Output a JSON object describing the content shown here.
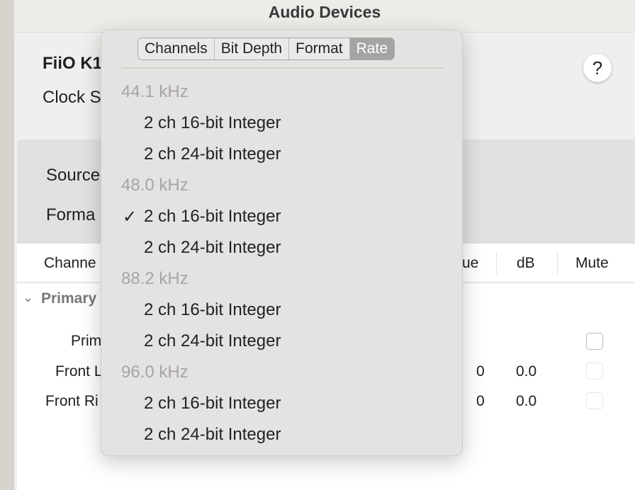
{
  "window": {
    "title": "Audio Devices"
  },
  "device": {
    "name": "FiiO K1",
    "clock_label": "Clock S"
  },
  "help_label": "?",
  "settings": {
    "source_label": "Source",
    "format_label": "Forma"
  },
  "table": {
    "headers": [
      "Channe",
      "ue",
      "dB",
      "Mute"
    ],
    "group": "Primary",
    "rows": [
      {
        "name": "Prim",
        "value": "",
        "db": "",
        "mute": false
      },
      {
        "name": "Front L",
        "value": "0",
        "db": "0.0",
        "mute": false
      },
      {
        "name": "Front Ri",
        "value": "0",
        "db": "0.0",
        "mute": false
      }
    ]
  },
  "popup": {
    "tabs": [
      {
        "label": "Channels",
        "selected": false
      },
      {
        "label": "Bit Depth",
        "selected": false
      },
      {
        "label": "Format",
        "selected": false
      },
      {
        "label": "Rate",
        "selected": true
      }
    ],
    "groups": [
      {
        "header": "44.1 kHz",
        "options": [
          {
            "label": "2 ch 16-bit Integer",
            "checked": false
          },
          {
            "label": "2 ch 24-bit Integer",
            "checked": false
          }
        ]
      },
      {
        "header": "48.0 kHz",
        "options": [
          {
            "label": "2 ch 16-bit Integer",
            "checked": true
          },
          {
            "label": "2 ch 24-bit Integer",
            "checked": false
          }
        ]
      },
      {
        "header": "88.2 kHz",
        "options": [
          {
            "label": "2 ch 16-bit Integer",
            "checked": false
          },
          {
            "label": "2 ch 24-bit Integer",
            "checked": false
          }
        ]
      },
      {
        "header": "96.0 kHz",
        "options": [
          {
            "label": "2 ch 16-bit Integer",
            "checked": false
          },
          {
            "label": "2 ch 24-bit Integer",
            "checked": false
          }
        ]
      }
    ],
    "check_glyph": "✓"
  }
}
